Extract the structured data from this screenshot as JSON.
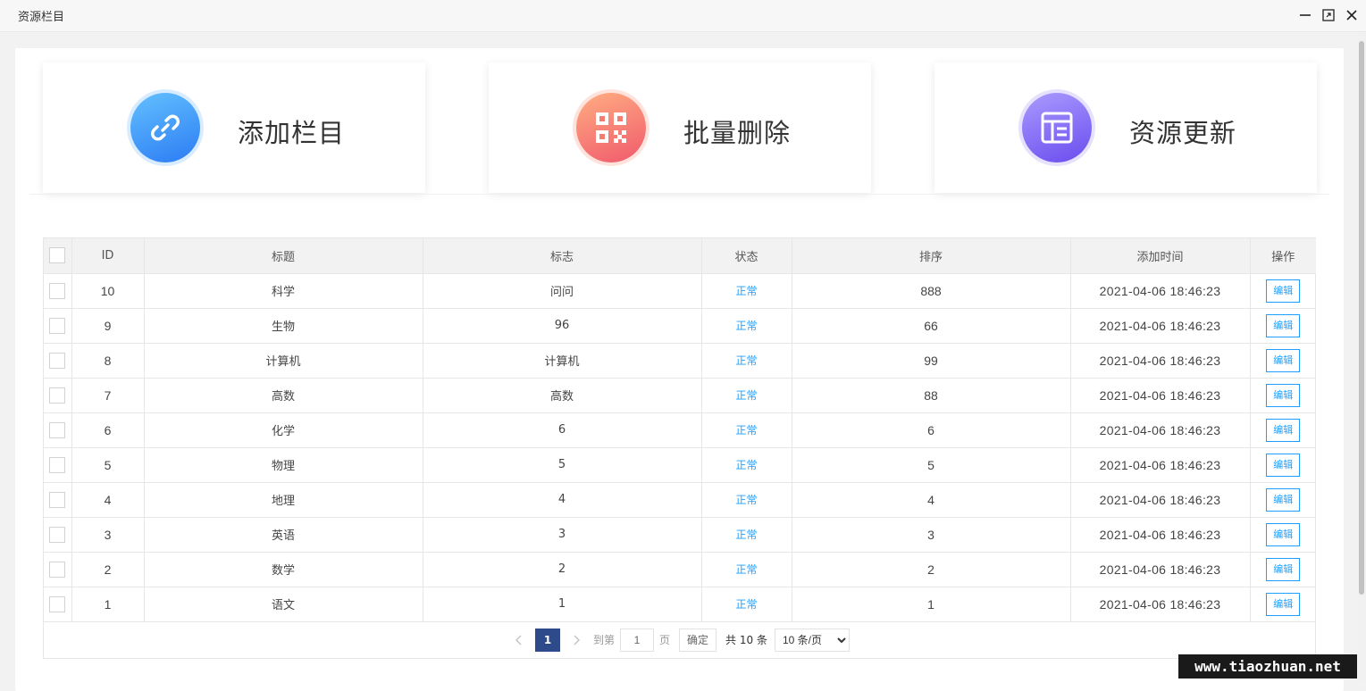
{
  "window": {
    "title": "资源栏目",
    "controls": [
      "minimize-icon",
      "maximize-icon",
      "close-icon"
    ]
  },
  "actions": [
    {
      "label": "添加栏目",
      "icon": "link-icon",
      "gradient": [
        "#58b8ff",
        "#2f80f5"
      ]
    },
    {
      "label": "批量删除",
      "icon": "qrcode-icon",
      "gradient": [
        "#ffa37a",
        "#f15e6e"
      ]
    },
    {
      "label": "资源更新",
      "icon": "layout-icon",
      "gradient": [
        "#a392ff",
        "#7052ef"
      ]
    }
  ],
  "table": {
    "columns": [
      "ID",
      "标题",
      "标志",
      "状态",
      "排序",
      "添加时间",
      "操作"
    ],
    "rows": [
      {
        "id": "10",
        "title": "科学",
        "flag": "问问",
        "status": "正常",
        "sort": "888",
        "time": "2021-04-06 18:46:23",
        "action": "编辑"
      },
      {
        "id": "9",
        "title": "生物",
        "flag": "96",
        "status": "正常",
        "sort": "66",
        "time": "2021-04-06 18:46:23",
        "action": "编辑"
      },
      {
        "id": "8",
        "title": "计算机",
        "flag": "计算机",
        "status": "正常",
        "sort": "99",
        "time": "2021-04-06 18:46:23",
        "action": "编辑"
      },
      {
        "id": "7",
        "title": "高数",
        "flag": "高数",
        "status": "正常",
        "sort": "88",
        "time": "2021-04-06 18:46:23",
        "action": "编辑"
      },
      {
        "id": "6",
        "title": "化学",
        "flag": "6",
        "status": "正常",
        "sort": "6",
        "time": "2021-04-06 18:46:23",
        "action": "编辑"
      },
      {
        "id": "5",
        "title": "物理",
        "flag": "5",
        "status": "正常",
        "sort": "5",
        "time": "2021-04-06 18:46:23",
        "action": "编辑"
      },
      {
        "id": "4",
        "title": "地理",
        "flag": "4",
        "status": "正常",
        "sort": "4",
        "time": "2021-04-06 18:46:23",
        "action": "编辑"
      },
      {
        "id": "3",
        "title": "英语",
        "flag": "3",
        "status": "正常",
        "sort": "3",
        "time": "2021-04-06 18:46:23",
        "action": "编辑"
      },
      {
        "id": "2",
        "title": "数学",
        "flag": "2",
        "status": "正常",
        "sort": "2",
        "time": "2021-04-06 18:46:23",
        "action": "编辑"
      },
      {
        "id": "1",
        "title": "语文",
        "flag": "1",
        "status": "正常",
        "sort": "1",
        "time": "2021-04-06 18:46:23",
        "action": "编辑"
      }
    ]
  },
  "pagination": {
    "current_page": "1",
    "goto_label": "到第",
    "goto_value": "1",
    "page_label": "页",
    "confirm_label": "确定",
    "total_label": "共 10 条",
    "page_size": "10 条/页"
  },
  "watermark": "www.tiaozhuan.net",
  "colors": {
    "accent": "#1e9fff",
    "page_active": "#2e4a8a"
  }
}
